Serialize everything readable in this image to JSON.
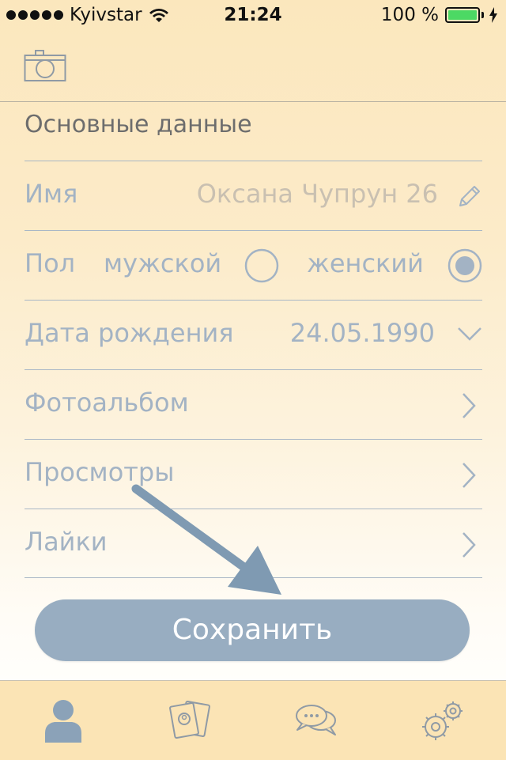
{
  "status_bar": {
    "carrier": "Kyivstar",
    "time": "21:24",
    "battery": "100 %",
    "icons": [
      "signal-dots-icon",
      "wifi-icon",
      "battery-icon",
      "charging-icon"
    ]
  },
  "header": {
    "icon": "camera-icon"
  },
  "section_title": "Основные данные",
  "fields": {
    "name": {
      "label": "Имя",
      "value": "Оксана Чупрун 26",
      "icon": "pencil-icon"
    },
    "gender": {
      "label": "Пол",
      "male": "мужской",
      "female": "женский",
      "selected": "женский"
    },
    "birthdate": {
      "label": "Дата рождения",
      "value": "24.05.1990",
      "icon": "chevron-down-icon"
    },
    "photo_album": {
      "label": "Фотоальбом",
      "icon": "chevron-right-icon"
    },
    "views": {
      "label": "Просмотры",
      "icon": "chevron-right-icon"
    },
    "likes": {
      "label": "Лайки",
      "icon": "chevron-right-icon"
    }
  },
  "save_button": {
    "label": "Сохранить"
  },
  "tab_bar": {
    "tabs": [
      "profile-icon",
      "cards-icon",
      "chat-icon",
      "settings-icon"
    ],
    "active": "profile-icon"
  },
  "colors": {
    "background_top": "#fbe7bd",
    "accent_blue": "#98adc1",
    "label_blue": "#a3b3c4",
    "annotation_arrow": "#7f9ab2"
  }
}
